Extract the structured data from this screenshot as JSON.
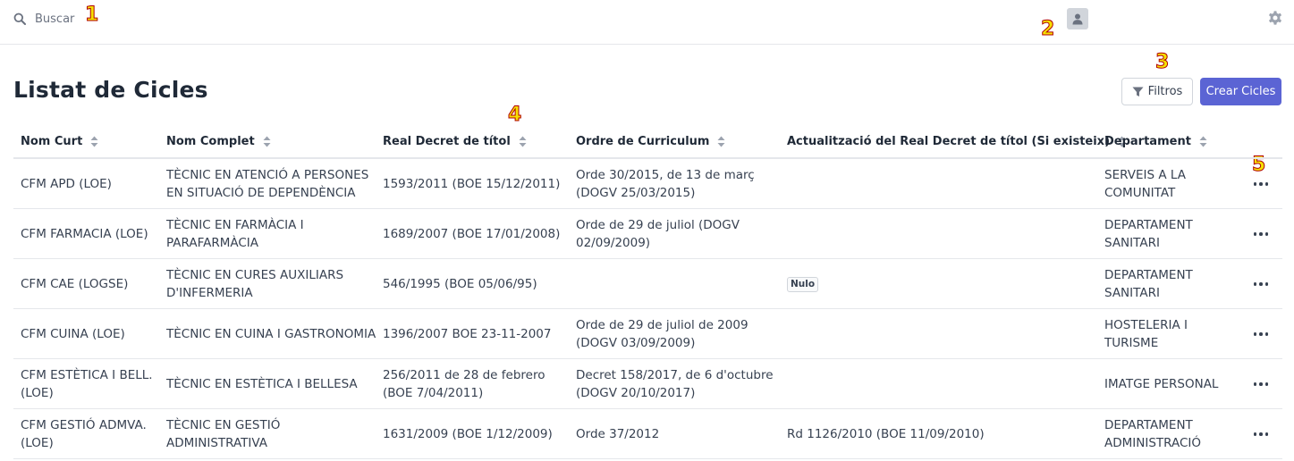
{
  "search": {
    "label": "Buscar"
  },
  "markers": [
    "1",
    "2",
    "3",
    "4",
    "5"
  ],
  "page": {
    "title": "Listat de Cicles"
  },
  "actions": {
    "filters_label": "Filtros",
    "create_label": "Crear Cicles"
  },
  "table": {
    "columns": [
      "Nom Curt",
      "Nom Complet",
      "Real Decret de títol",
      "Ordre de Curriculum",
      "Actualització del Real Decret de títol (Si existeix)",
      "Departament"
    ],
    "rows": [
      {
        "nom_curt": [
          "CFM APD (LOE)"
        ],
        "nom_complet": [
          "TÈCNIC EN ATENCIÓ A PERSONES",
          "EN SITUACIÓ DE DEPENDÈNCIA"
        ],
        "real_decret": [
          "1593/2011 (BOE 15/12/2011)"
        ],
        "ordre": [
          "Orde 30/2015, de 13 de març",
          "(DOGV 25/03/2015)"
        ],
        "actualitzacio": [],
        "actualitzacio_badge": "",
        "departament": [
          "SERVEIS A LA",
          "COMUNITAT"
        ]
      },
      {
        "nom_curt": [
          "CFM FARMACIA (LOE)"
        ],
        "nom_complet": [
          "TÈCNIC EN FARMÀCIA I",
          "PARAFARMÀCIA"
        ],
        "real_decret": [
          "1689/2007 (BOE 17/01/2008)"
        ],
        "ordre": [
          "Orde de 29 de juliol (DOGV",
          "02/09/2009)"
        ],
        "actualitzacio": [],
        "actualitzacio_badge": "",
        "departament": [
          "DEPARTAMENT",
          "SANITARI"
        ]
      },
      {
        "nom_curt": [
          "CFM CAE (LOGSE)"
        ],
        "nom_complet": [
          "TÈCNIC EN CURES AUXILIARS",
          "D'INFERMERIA"
        ],
        "real_decret": [
          "546/1995 (BOE 05/06/95)"
        ],
        "ordre": [],
        "actualitzacio": [],
        "actualitzacio_badge": "Nulo",
        "departament": [
          "DEPARTAMENT",
          "SANITARI"
        ]
      },
      {
        "nom_curt": [
          "CFM CUINA (LOE)"
        ],
        "nom_complet": [
          "TÈCNIC EN CUINA I GASTRONOMIA"
        ],
        "real_decret": [
          "1396/2007 BOE 23-11-2007"
        ],
        "ordre": [
          "Orde de 29 de juliol de 2009",
          "(DOGV 03/09/2009)"
        ],
        "actualitzacio": [],
        "actualitzacio_badge": "",
        "departament": [
          "HOSTELERIA I",
          "TURISME"
        ]
      },
      {
        "nom_curt": [
          "CFM ESTÈTICA I BELL.",
          "(LOE)"
        ],
        "nom_complet": [
          "TÈCNIC EN ESTÈTICA I BELLESA"
        ],
        "real_decret": [
          "256/2011 de 28 de febrero",
          "(BOE 7/04/2011)"
        ],
        "ordre": [
          "Decret 158/2017, de 6 d'octubre",
          "(DOGV 20/10/2017)"
        ],
        "actualitzacio": [],
        "actualitzacio_badge": "",
        "departament": [
          "IMATGE PERSONAL"
        ]
      },
      {
        "nom_curt": [
          "CFM GESTIÓ ADMVA.",
          "(LOE)"
        ],
        "nom_complet": [
          "TÈCNIC EN GESTIÓ",
          "ADMINISTRATIVA"
        ],
        "real_decret": [
          "1631/2009 (BOE 1/12/2009)"
        ],
        "ordre": [
          "Orde 37/2012"
        ],
        "actualitzacio": [
          "Rd 1126/2010 (BOE 11/09/2010)"
        ],
        "actualitzacio_badge": "",
        "departament": [
          "DEPARTAMENT",
          "ADMINISTRACIÓ"
        ]
      }
    ]
  }
}
